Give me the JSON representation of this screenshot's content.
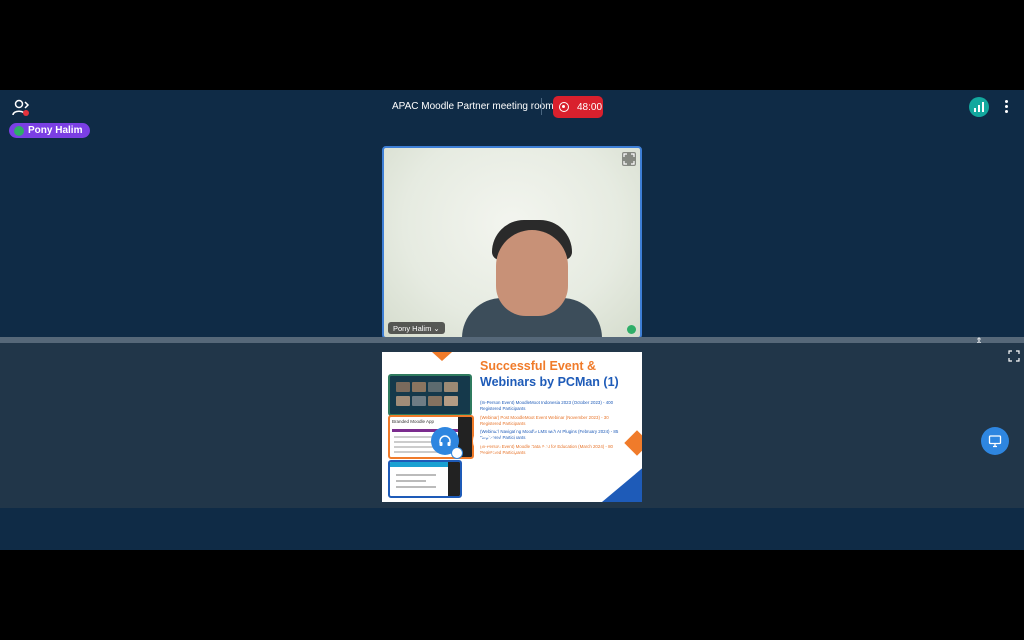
{
  "header": {
    "room_title": "APAC Moodle Partner meeting room",
    "recording_time": "48:00"
  },
  "presenter": {
    "badge_name": "Pony Halim"
  },
  "webcam": {
    "name_tag": "Pony Halim ⌄"
  },
  "slide": {
    "title_line1": "Successful Event &",
    "title_line2_a": "Webinars",
    "title_line2_b": " by PCMan (1)",
    "items": [
      "(In-Person Event) MoodleMoot Indonesia 2023 (October 2023) - 400 Registered Participants",
      "(Webinar) Post MoodleMoot Event Webinar (November 2023) - 30 Registered Participants",
      "(Webinar) Navigating Moodle LMS with AI Plugins (February 2024) - 85 Registered Participants",
      "(In-Person Event) Moodle Data & AI for Education (March 2024) - 80 Registered Participants"
    ],
    "screenshot2_header": "Branded Moodle App"
  },
  "colors": {
    "app_bg": "#0f2b46",
    "record_red": "#d9202d",
    "accent_blue": "#2e86e0",
    "presenter_purple": "#7b3fe4",
    "slide_orange": "#f07b2a",
    "slide_blue": "#1e5bb8"
  },
  "icons": {
    "users": "users-icon",
    "record": "record-icon",
    "connection": "connection-status-icon",
    "more": "more-options-icon",
    "expand": "fullscreen-icon",
    "audio": "headphones-icon",
    "camera": "camera-off-icon",
    "hand": "raise-hand-icon",
    "share": "screen-share-icon"
  }
}
